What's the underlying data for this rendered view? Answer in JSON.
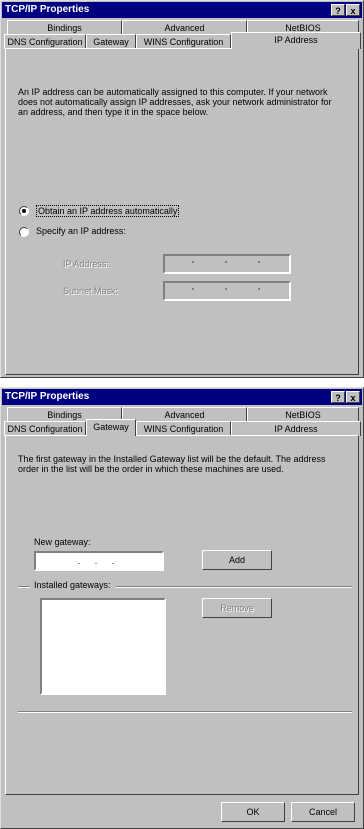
{
  "dialog1": {
    "title": "TCP/IP Properties",
    "help_btn": "?",
    "close_btn": "x",
    "tabs_row1": [
      "Bindings",
      "Advanced",
      "NetBIOS"
    ],
    "tabs_row2": [
      "DNS Configuration",
      "Gateway",
      "WINS Configuration",
      "IP Address"
    ],
    "active_tab": "IP Address",
    "description": "An IP address can be automatically assigned to this computer. If your network does not automatically assign IP addresses, ask your network administrator for an address, and then type it in the space below.",
    "radio_auto": "Obtain an IP address automatically",
    "radio_specify": "Specify an IP address:",
    "ip_label": "IP Address:",
    "subnet_label": "Subnet Mask:"
  },
  "dialog2": {
    "title": "TCP/IP Properties",
    "help_btn": "?",
    "close_btn": "x",
    "tabs_row1": [
      "Bindings",
      "Advanced",
      "NetBIOS"
    ],
    "tabs_row2": [
      "DNS Configuration",
      "Gateway",
      "WINS Configuration",
      "IP Address"
    ],
    "active_tab": "Gateway",
    "description": "The first gateway in the Installed Gateway list will be the default. The address order in the list will be the order in which these machines are used.",
    "new_gateway_label": "New gateway:",
    "new_gateway_value": ".   .   .",
    "add_button": "Add",
    "installed_label": "Installed gateways:",
    "remove_button": "Remove",
    "ok_button": "OK",
    "cancel_button": "Cancel"
  }
}
